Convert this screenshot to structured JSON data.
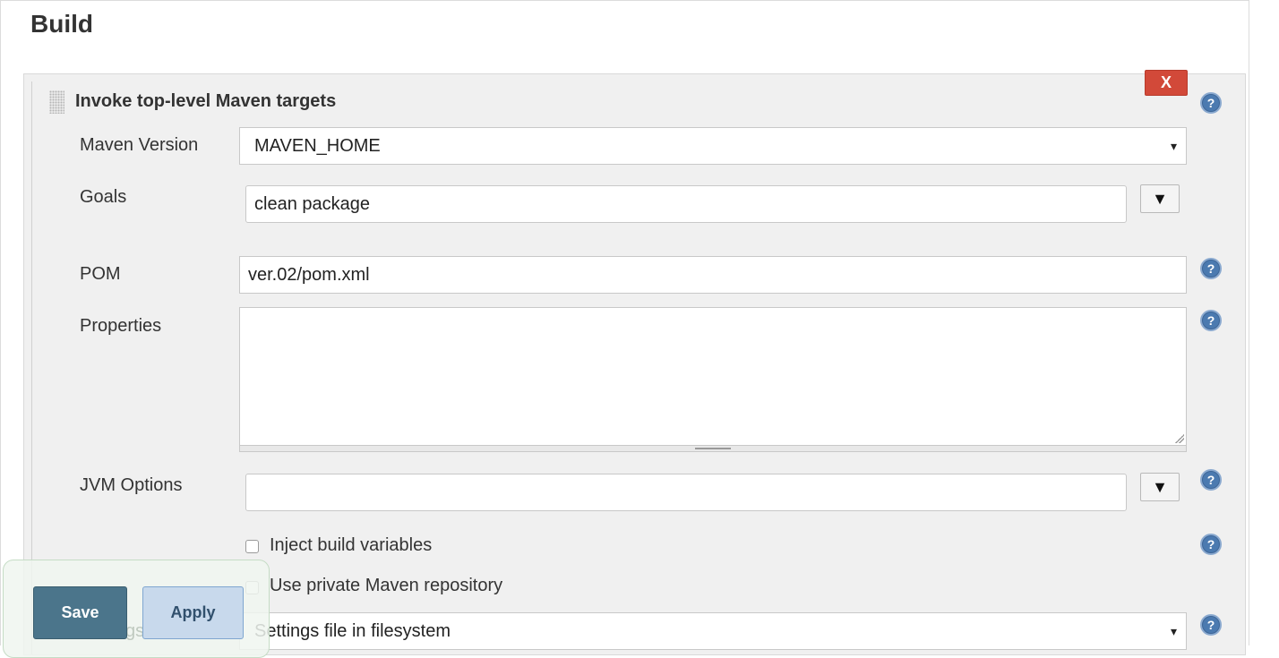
{
  "section": {
    "title": "Build"
  },
  "build_step": {
    "title": "Invoke top-level Maven targets",
    "delete_label": "X",
    "maven_version": {
      "label": "Maven Version",
      "value": "MAVEN_HOME",
      "arrow": "▾"
    },
    "goals": {
      "label": "Goals",
      "value": "clean package",
      "expand": "▼"
    },
    "pom": {
      "label": "POM",
      "value": "ver.02/pom.xml"
    },
    "properties": {
      "label": "Properties",
      "value": ""
    },
    "jvm_options": {
      "label": "JVM Options",
      "value": "",
      "expand": "▼"
    },
    "inject_build_variables": {
      "label": "Inject build variables",
      "checked": false
    },
    "private_repository": {
      "label": "Use private Maven repository",
      "checked": false
    },
    "settings": {
      "label": "Settings",
      "value": "Settings file in filesystem",
      "arrow": "▾"
    }
  },
  "footer": {
    "save_label": "Save",
    "apply_label": "Apply",
    "obscured_label": "gs"
  },
  "colors": {
    "delete": "#d24939",
    "save": "#4b758b",
    "apply": "#c8d9ec",
    "help": "#4b7ab0"
  },
  "icons": [
    "drag-handle-icon",
    "help-icon",
    "dropdown-arrow-icon",
    "expand-icon"
  ]
}
